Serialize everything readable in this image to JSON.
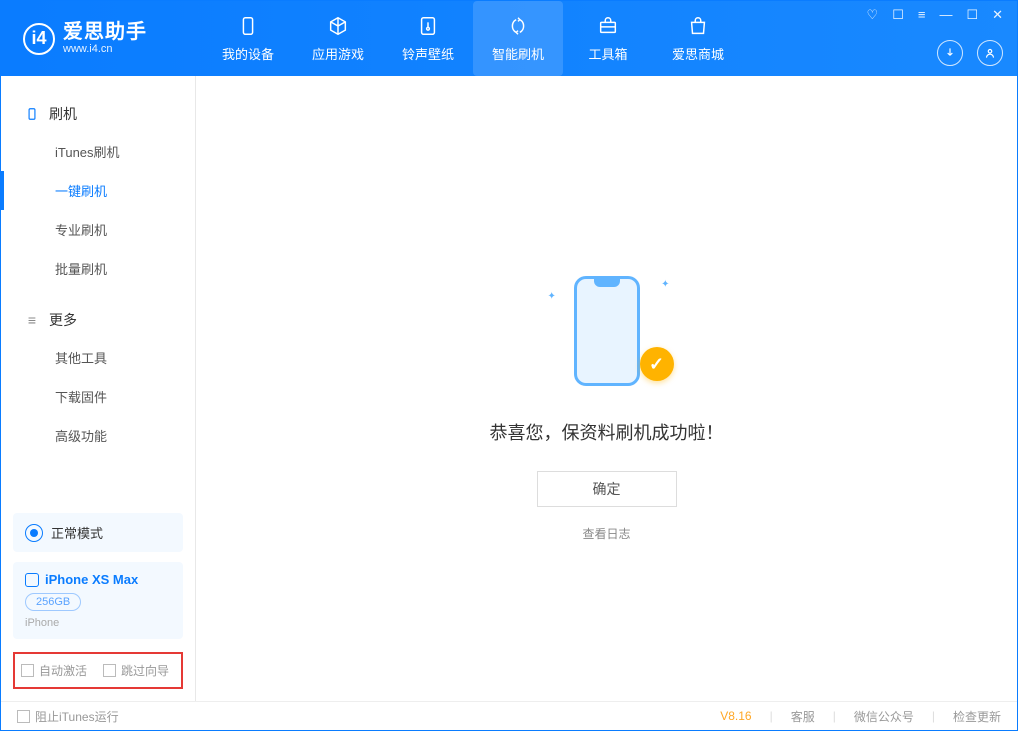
{
  "brand": {
    "title": "爱思助手",
    "subtitle": "www.i4.cn"
  },
  "nav": {
    "items": [
      {
        "label": "我的设备"
      },
      {
        "label": "应用游戏"
      },
      {
        "label": "铃声壁纸"
      },
      {
        "label": "智能刷机"
      },
      {
        "label": "工具箱"
      },
      {
        "label": "爱思商城"
      }
    ]
  },
  "sidebar": {
    "group1": {
      "title": "刷机",
      "items": [
        "iTunes刷机",
        "一键刷机",
        "专业刷机",
        "批量刷机"
      ]
    },
    "group2": {
      "title": "更多",
      "items": [
        "其他工具",
        "下载固件",
        "高级功能"
      ]
    },
    "mode": "正常模式",
    "device": {
      "name": "iPhone XS Max",
      "storage": "256GB",
      "type": "iPhone"
    },
    "checkboxes": {
      "auto_activate": "自动激活",
      "skip_guide": "跳过向导"
    }
  },
  "main": {
    "success_text": "恭喜您，保资料刷机成功啦！",
    "ok_button": "确定",
    "view_log": "查看日志"
  },
  "footer": {
    "block_itunes": "阻止iTunes运行",
    "version": "V8.16",
    "links": [
      "客服",
      "微信公众号",
      "检查更新"
    ]
  }
}
